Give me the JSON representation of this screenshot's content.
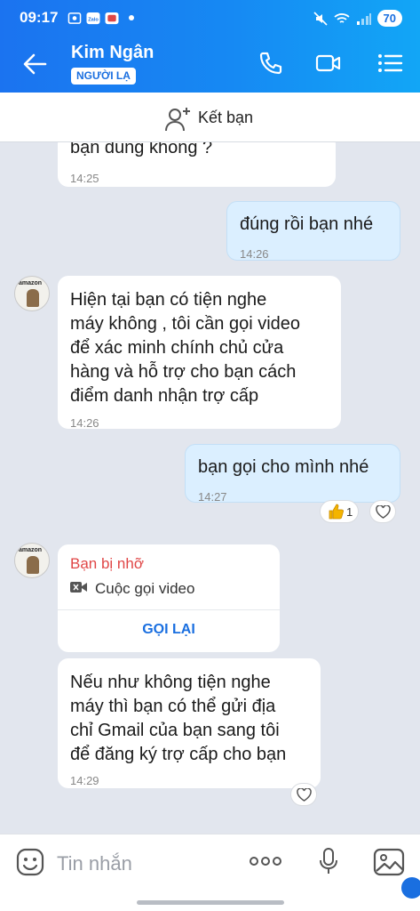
{
  "status_bar": {
    "time": "09:17",
    "battery": "70"
  },
  "header": {
    "contact_name": "Kim Ngân",
    "stranger_label": "NGƯỜI LẠ"
  },
  "add_friend": {
    "label": "Kết bạn"
  },
  "messages": [
    {
      "direction": "in",
      "text": [
        "bạn  đúng không ?"
      ],
      "time": "14:25"
    },
    {
      "direction": "out",
      "text": [
        "đúng rồi bạn nhé"
      ],
      "time": "14:26"
    },
    {
      "direction": "in",
      "text": [
        "Hiện tại bạn có tiện nghe",
        "máy không , tôi cần gọi video",
        "để xác minh chính chủ cửa",
        "hàng và hỗ trợ cho bạn cách",
        "điểm danh nhận trợ cấp"
      ],
      "time": "14:26"
    },
    {
      "direction": "out",
      "text": [
        "bạn gọi cho mình nhé"
      ],
      "time": "14:27",
      "reaction_count": "1"
    },
    {
      "direction": "in",
      "text": [
        "Nếu như không tiện nghe",
        "máy thì bạn có thể gửi địa",
        "chỉ Gmail của bạn sang tôi",
        "để đăng ký trợ cấp cho bạn"
      ],
      "time": "14:29"
    }
  ],
  "avatar_brand": "amazon",
  "missed_call": {
    "title": "Bạn bị nhỡ",
    "type": "Cuộc gọi video",
    "action": "GỌI LẠI"
  },
  "composer": {
    "placeholder": "Tin nhắn"
  },
  "colors": {
    "primary": "#1a6fe0",
    "missed": "#e04646",
    "outgoing_bubble": "#dbefff"
  }
}
